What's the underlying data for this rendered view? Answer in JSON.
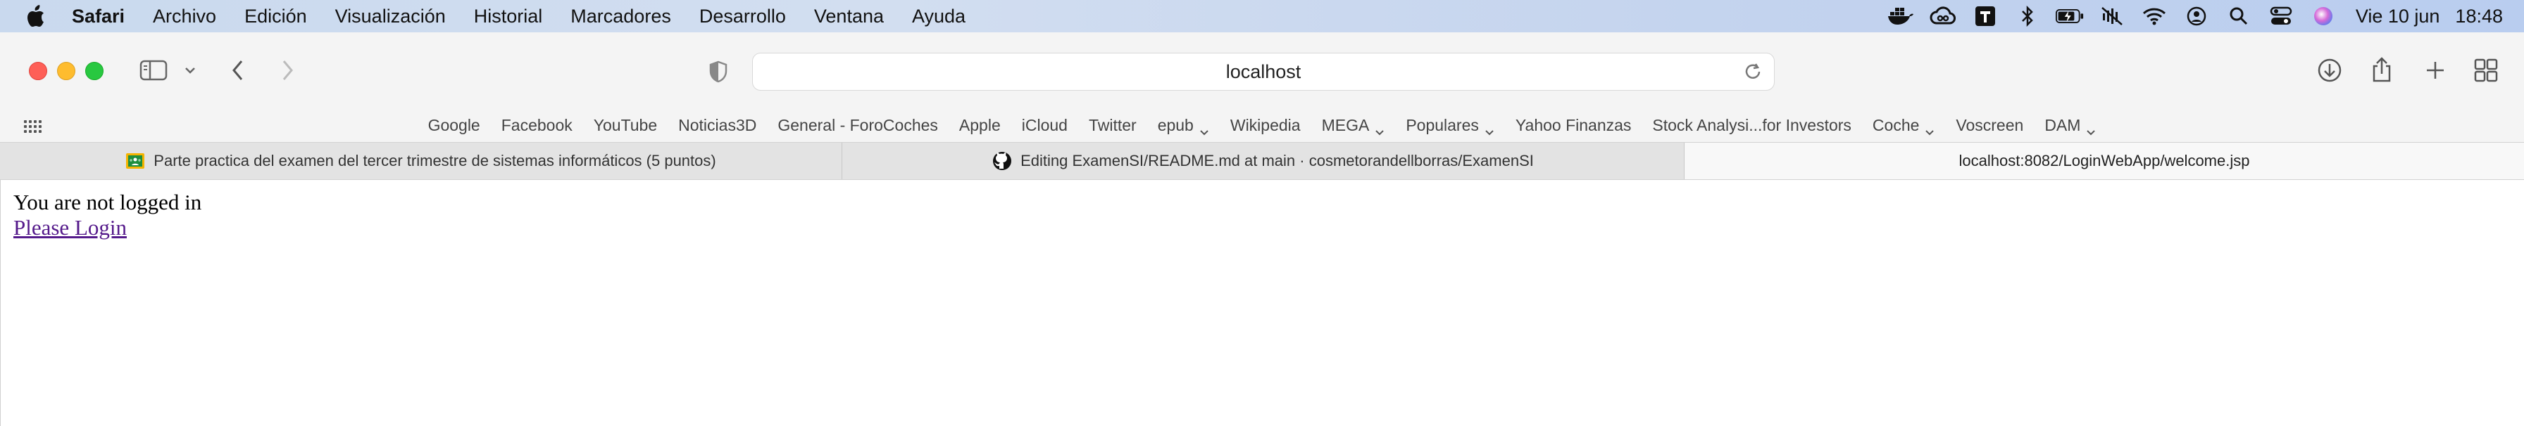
{
  "menubar": {
    "app_name": "Safari",
    "items": [
      "Archivo",
      "Edición",
      "Visualización",
      "Historial",
      "Marcadores",
      "Desarrollo",
      "Ventana",
      "Ayuda"
    ],
    "date": "Vie 10 jun",
    "time": "18:48",
    "status_icons": [
      "docker-icon",
      "creative-cloud-icon",
      "typora-icon",
      "bluetooth-icon",
      "battery-icon",
      "muted-icon",
      "wifi-icon",
      "user-icon",
      "spotlight-icon",
      "control-center-icon",
      "siri-icon"
    ]
  },
  "toolbar": {
    "address": "localhost"
  },
  "favorites": [
    {
      "label": "Google",
      "menu": false
    },
    {
      "label": "Facebook",
      "menu": false
    },
    {
      "label": "YouTube",
      "menu": false
    },
    {
      "label": "Noticias3D",
      "menu": false
    },
    {
      "label": "General - ForoCoches",
      "menu": false
    },
    {
      "label": "Apple",
      "menu": false
    },
    {
      "label": "iCloud",
      "menu": false
    },
    {
      "label": "Twitter",
      "menu": false
    },
    {
      "label": "epub",
      "menu": true
    },
    {
      "label": "Wikipedia",
      "menu": false
    },
    {
      "label": "MEGA",
      "menu": true
    },
    {
      "label": "Populares",
      "menu": true
    },
    {
      "label": "Yahoo Finanzas",
      "menu": false
    },
    {
      "label": "Stock Analysi...for Investors",
      "menu": false
    },
    {
      "label": "Coche",
      "menu": true
    },
    {
      "label": "Voscreen",
      "menu": false
    },
    {
      "label": "DAM",
      "menu": true
    }
  ],
  "tabs": [
    {
      "title": "Parte practica del examen del tercer trimestre de sistemas informáticos (5 puntos)",
      "icon": "classroom-icon",
      "active": false
    },
    {
      "title": "Editing ExamenSI/README.md at main · cosmetorandellborras/ExamenSI",
      "icon": "github-icon",
      "active": false
    },
    {
      "title": "localhost:8082/LoginWebApp/welcome.jsp",
      "icon": "",
      "active": true
    }
  ],
  "page": {
    "status_text": "You are not logged in",
    "login_link": "Please Login"
  },
  "colors": {
    "close": "#fe5f57",
    "minimize": "#febc2e",
    "maximize": "#28c840",
    "link_visited": "#551a8b"
  }
}
